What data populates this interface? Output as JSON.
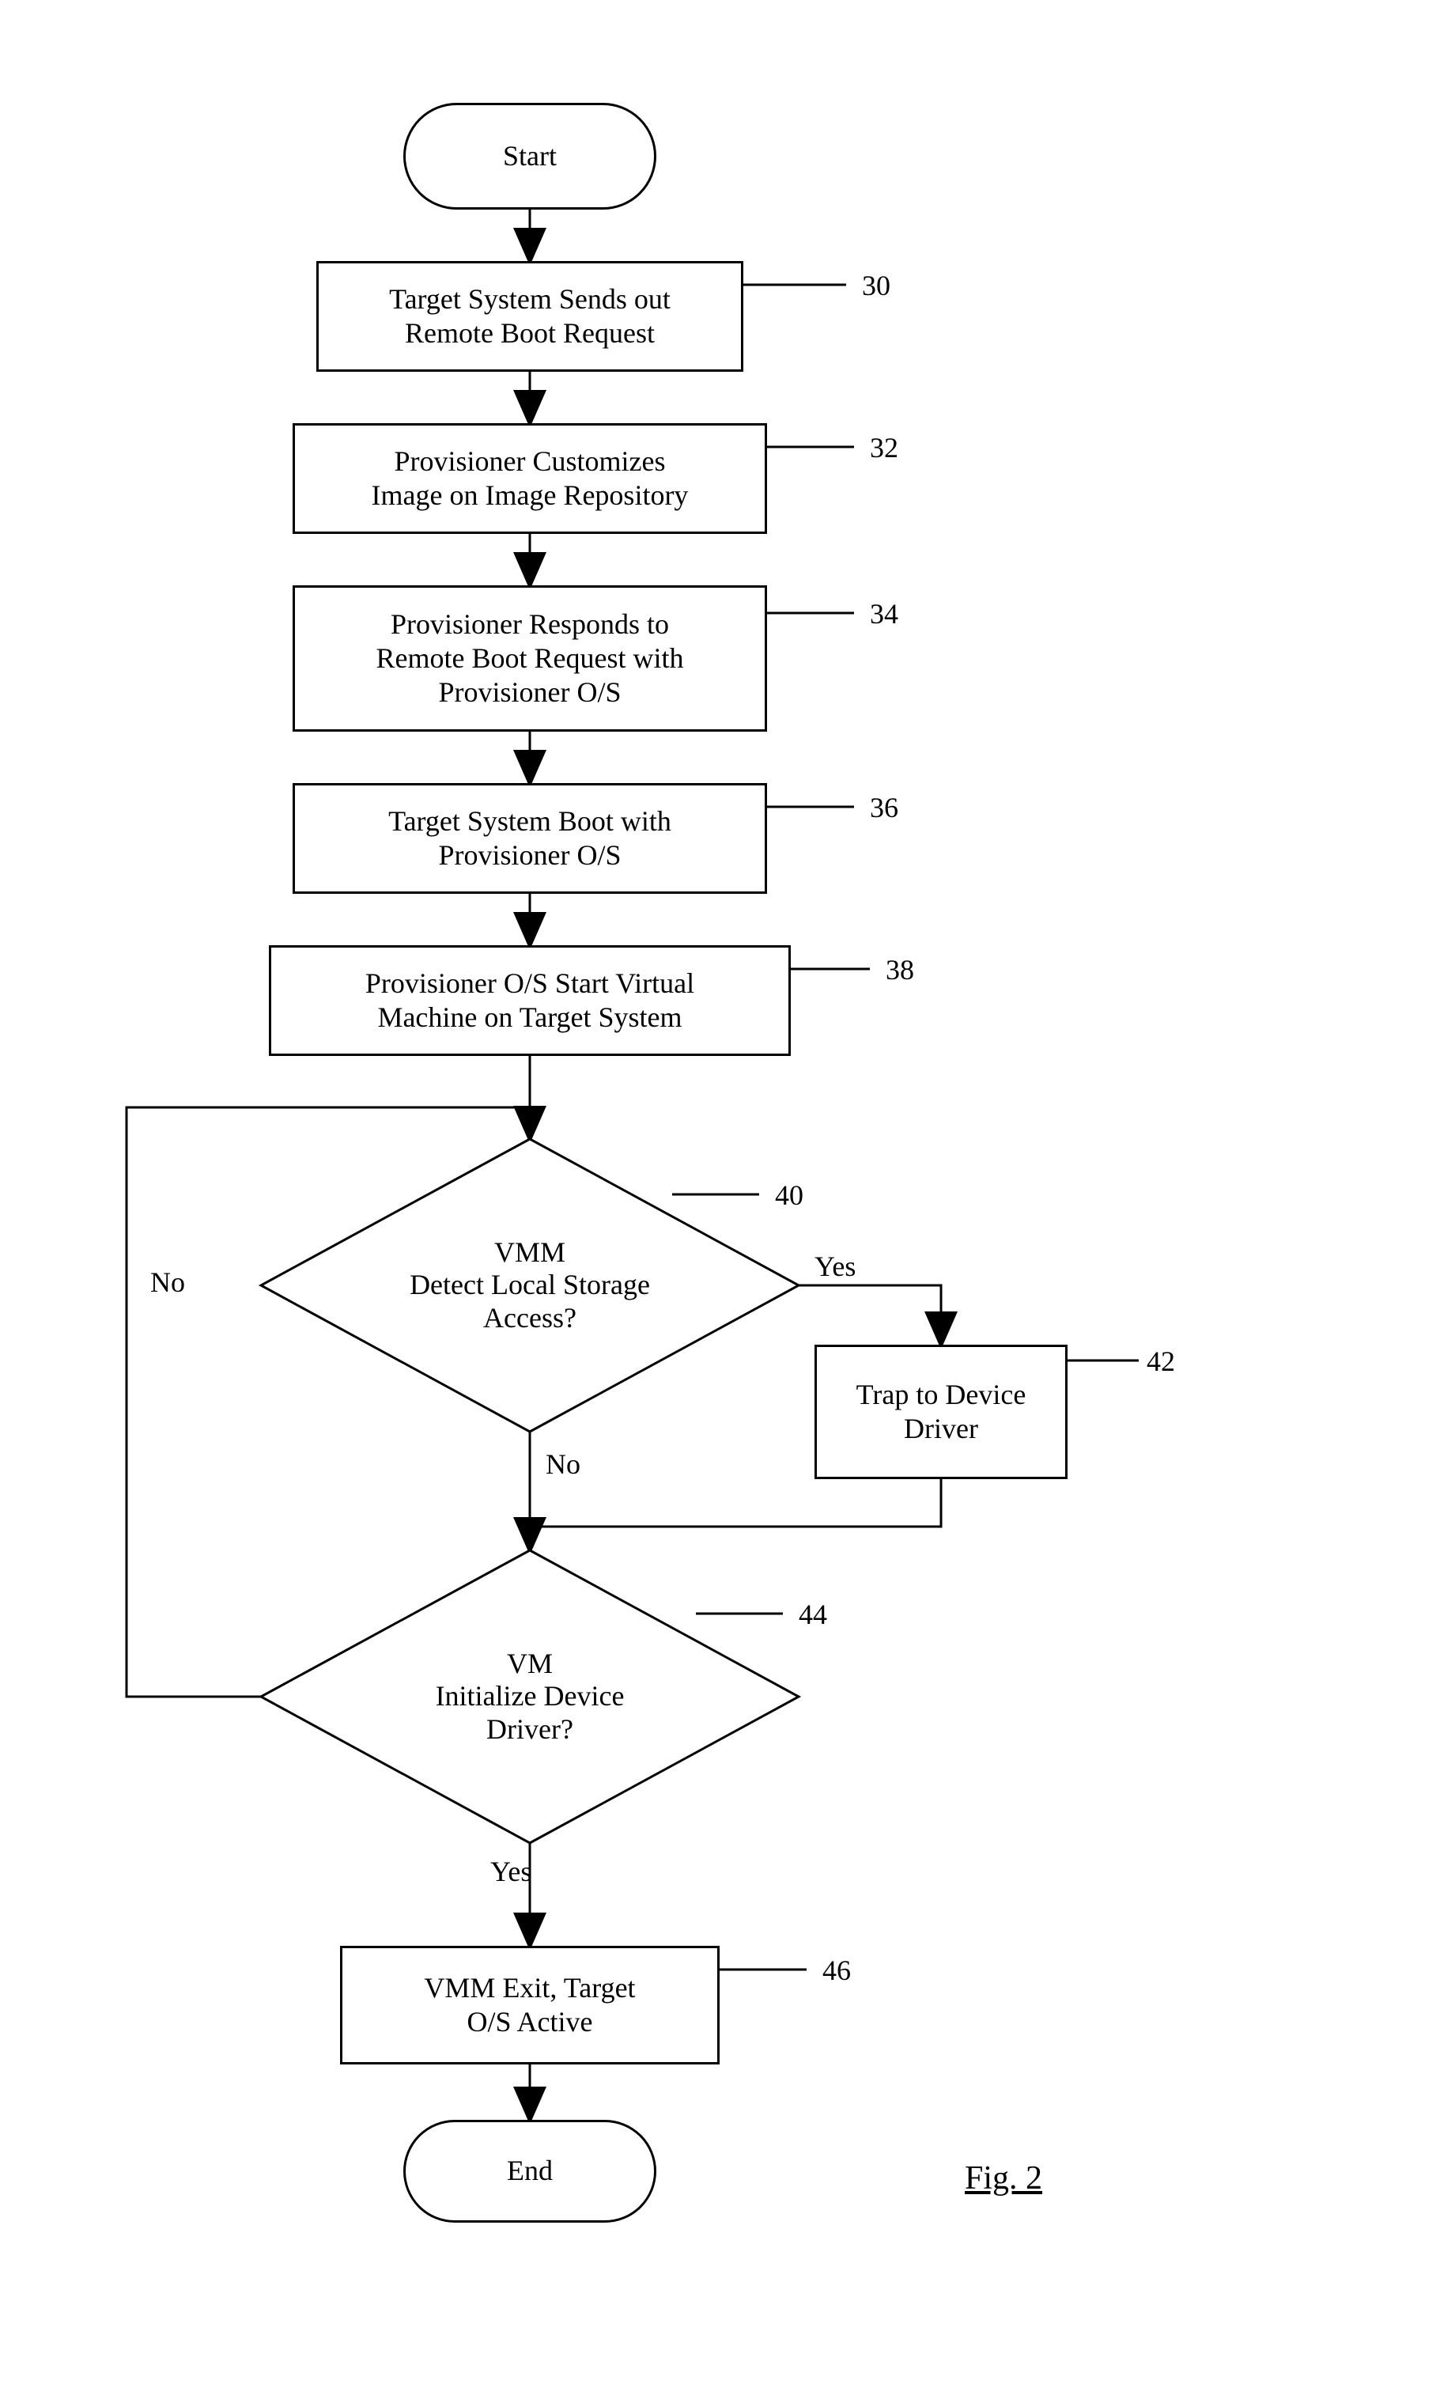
{
  "chart_data": {
    "type": "flowchart",
    "nodes": [
      {
        "id": "start",
        "type": "terminator",
        "label": "Start"
      },
      {
        "id": "n30",
        "type": "process",
        "ref": "30",
        "label": "Target System Sends out Remote Boot Request"
      },
      {
        "id": "n32",
        "type": "process",
        "ref": "32",
        "label": "Provisioner Customizes Image on Image Repository"
      },
      {
        "id": "n34",
        "type": "process",
        "ref": "34",
        "label": "Provisioner Responds to Remote Boot Request with Provisioner O/S"
      },
      {
        "id": "n36",
        "type": "process",
        "ref": "36",
        "label": "Target System Boot with Provisioner O/S"
      },
      {
        "id": "n38",
        "type": "process",
        "ref": "38",
        "label": "Provisioner O/S Start Virtual Machine on Target System"
      },
      {
        "id": "d40",
        "type": "decision",
        "ref": "40",
        "label": "VMM Detect Local Storage Access?"
      },
      {
        "id": "n42",
        "type": "process",
        "ref": "42",
        "label": "Trap to Device Driver"
      },
      {
        "id": "d44",
        "type": "decision",
        "ref": "44",
        "label": "VM Initialize Device Driver?"
      },
      {
        "id": "n46",
        "type": "process",
        "ref": "46",
        "label": "VMM Exit, Target O/S Active"
      },
      {
        "id": "end",
        "type": "terminator",
        "label": "End"
      }
    ],
    "edges": [
      {
        "from": "start",
        "to": "n30"
      },
      {
        "from": "n30",
        "to": "n32"
      },
      {
        "from": "n32",
        "to": "n34"
      },
      {
        "from": "n34",
        "to": "n36"
      },
      {
        "from": "n36",
        "to": "n38"
      },
      {
        "from": "n38",
        "to": "d40"
      },
      {
        "from": "d40",
        "to": "n42",
        "label": "Yes"
      },
      {
        "from": "d40",
        "to": "d44",
        "label": "No"
      },
      {
        "from": "n42",
        "to": "d44"
      },
      {
        "from": "d44",
        "to": "n46",
        "label": "Yes"
      },
      {
        "from": "d44",
        "to": "d40",
        "label": "No",
        "note": "loop back via left side into top of d40 merge"
      },
      {
        "from": "n46",
        "to": "end"
      }
    ],
    "figure_label": "Fig. 2"
  },
  "text": {
    "start": "Start",
    "end": "End",
    "n30": "Target System Sends out\nRemote Boot Request",
    "n32": "Provisioner Customizes\nImage on Image Repository",
    "n34": "Provisioner Responds to\nRemote Boot Request with\nProvisioner O/S",
    "n36": "Target System Boot with\nProvisioner O/S",
    "n38": "Provisioner O/S Start Virtual\nMachine on Target System",
    "d40": "VMM\nDetect Local Storage\nAccess?",
    "n42": "Trap to Device\nDriver",
    "d44": "VM\nInitialize Device\nDriver?",
    "n46": "VMM Exit, Target\nO/S Active",
    "ref30": "30",
    "ref32": "32",
    "ref34": "34",
    "ref36": "36",
    "ref38": "38",
    "ref40": "40",
    "ref42": "42",
    "ref44": "44",
    "ref46": "46",
    "yes": "Yes",
    "no": "No",
    "fig": "Fig. 2"
  }
}
